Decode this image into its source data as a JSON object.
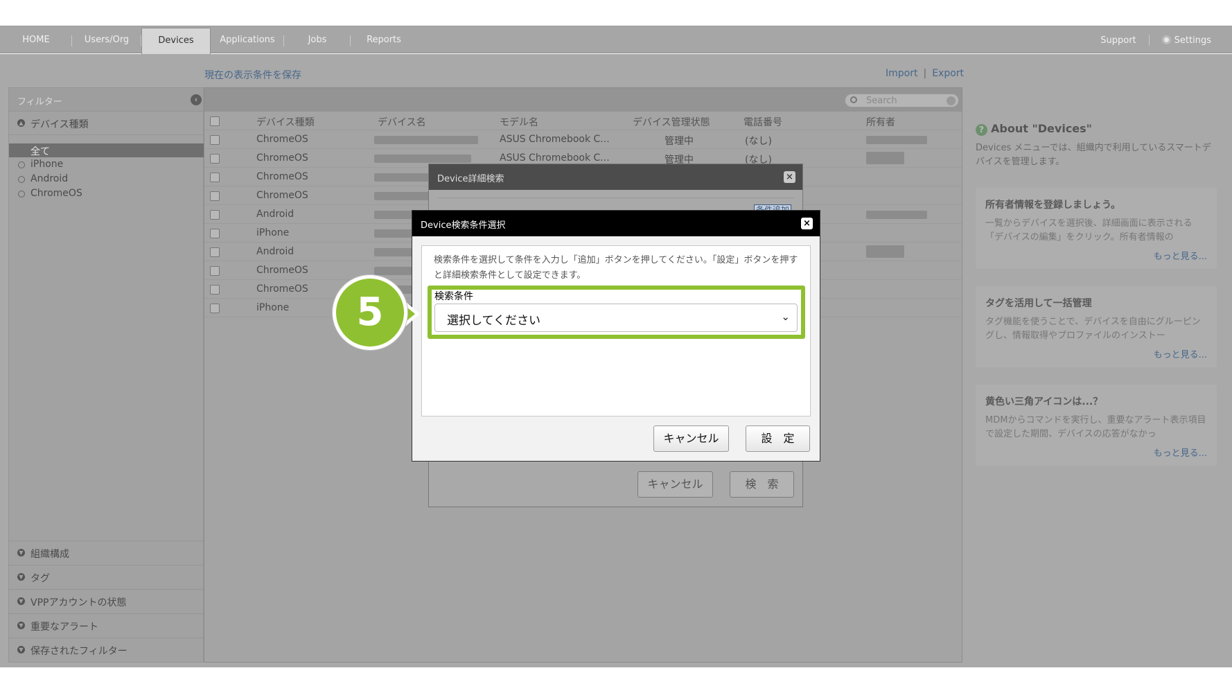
{
  "nav": {
    "tabs": [
      {
        "label": "HOME"
      },
      {
        "label": "Users/Org"
      },
      {
        "label": "Devices"
      },
      {
        "label": "Applications"
      },
      {
        "label": "Jobs"
      },
      {
        "label": "Reports"
      }
    ],
    "active_tab": "Devices",
    "support": "Support",
    "settings": "Settings"
  },
  "toolbar": {
    "save_view": "現在の表示条件を保存",
    "import": "Import",
    "export": "Export",
    "separator": "|"
  },
  "sidebar": {
    "title": "フィルター",
    "device_type": "デバイス種類",
    "items": [
      {
        "label": "全て",
        "selected": true
      },
      {
        "label": "iPhone"
      },
      {
        "label": "Android"
      },
      {
        "label": "ChromeOS"
      }
    ],
    "bottom": [
      {
        "label": "組織構成"
      },
      {
        "label": "タグ"
      },
      {
        "label": "VPPアカウントの状態"
      },
      {
        "label": "重要なアラート"
      },
      {
        "label": "保存されたフィルター"
      }
    ]
  },
  "search": {
    "placeholder": "Search"
  },
  "table": {
    "columns": [
      "デバイス種類",
      "デバイス名",
      "モデル名",
      "デバイス管理状態",
      "電話番号",
      "所有者"
    ],
    "rows": [
      {
        "type": "ChromeOS",
        "model": "ASUS Chromebook C...",
        "status": "管理中",
        "phone": "(なし)"
      },
      {
        "type": "ChromeOS",
        "model": "ASUS Chromebook C...",
        "status": "管理中",
        "phone": "(なし)"
      },
      {
        "type": "ChromeOS"
      },
      {
        "type": "ChromeOS"
      },
      {
        "type": "Android"
      },
      {
        "type": "iPhone"
      },
      {
        "type": "Android"
      },
      {
        "type": "ChromeOS"
      },
      {
        "type": "ChromeOS"
      },
      {
        "type": "iPhone"
      }
    ]
  },
  "info": {
    "title": "About \"Devices\"",
    "description": "Devices メニューでは、組織内で利用しているスマートデバイスを管理します。",
    "cards": [
      {
        "heading": "所有者情報を登録しましょう。",
        "body": "一覧からデバイスを選択後、詳細画面に表示される「デバイスの編集」をクリック。所有者情報の",
        "more": "もっと見る..."
      },
      {
        "heading": "タグを活用して一括管理",
        "body": "タグ機能を使うことで、デバイスを自由にグルーピングし、情報取得やプロファイルのインストー",
        "more": "もっと見る..."
      },
      {
        "heading": "黄色い三角アイコンは...？",
        "body": "MDMからコマンドを実行し、重要なアラート表示項目で設定した期間、デバイスの応答がなかっ",
        "more": "もっと見る..."
      }
    ]
  },
  "modal_back": {
    "title": "Device詳細検索",
    "add_condition": "条件追加",
    "cancel": "キャンセル",
    "search": "検　索"
  },
  "modal_front": {
    "title": "Device検索条件選択",
    "instructions": "検索条件を選択して条件を入力し「追加」ボタンを押してください。「設定」ボタンを押すと詳細検索条件として設定できます。",
    "condition_label": "検索条件",
    "condition_value": "選択してください",
    "cancel": "キャンセル",
    "set": "設　定"
  },
  "callout": {
    "step": "5"
  },
  "colors": {
    "accent_green": "#8fc031",
    "link": "#47678a",
    "modal_bar": "#000000"
  }
}
